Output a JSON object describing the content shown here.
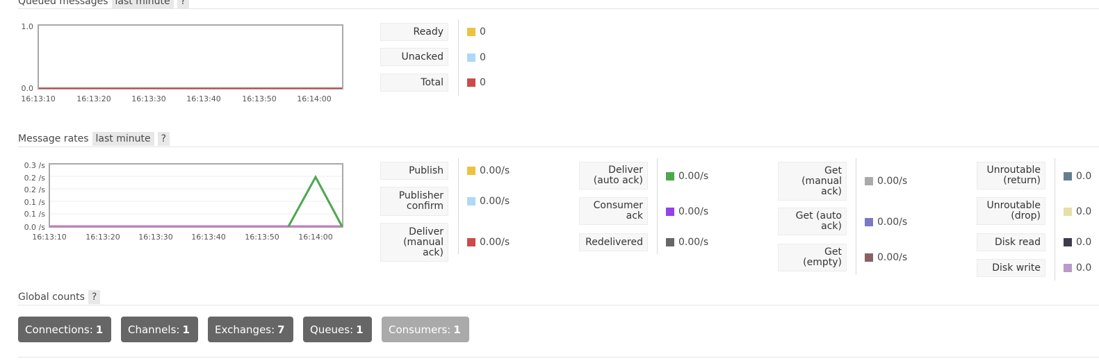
{
  "queued": {
    "title": "Queued messages",
    "range": "last minute",
    "help": "?",
    "chart_data": {
      "type": "line",
      "y_ticks": [
        "1.0",
        "0.0"
      ],
      "x_ticks": [
        "16:13:10",
        "16:13:20",
        "16:13:30",
        "16:13:40",
        "16:13:50",
        "16:14:00"
      ],
      "ylim": [
        0,
        1
      ],
      "series": [
        {
          "name": "Total",
          "color": "#dd4444",
          "values": [
            0,
            0,
            0,
            0,
            0,
            0,
            0
          ]
        }
      ]
    },
    "legend": [
      {
        "label": "Ready",
        "value": "0",
        "color": "#edc240"
      },
      {
        "label": "Unacked",
        "value": "0",
        "color": "#afd8f8"
      },
      {
        "label": "Total",
        "value": "0",
        "color": "#cb4b4b"
      }
    ]
  },
  "rates": {
    "title": "Message rates",
    "range": "last minute",
    "help": "?",
    "chart_data": {
      "type": "line",
      "y_ticks": [
        "0.3 /s",
        "0.2 /s",
        "0.2 /s",
        "0.1 /s",
        "0.1 /s",
        "0.0 /s"
      ],
      "x_ticks": [
        "16:13:10",
        "16:13:20",
        "16:13:30",
        "16:13:40",
        "16:13:50",
        "16:14:00"
      ],
      "ylim": [
        0,
        0.3
      ],
      "series": [
        {
          "name": "Deliver (auto ack)",
          "color": "#4da74d",
          "x": [
            "16:13:55",
            "16:14:00",
            "16:14:05"
          ],
          "values": [
            0,
            0.2,
            0
          ]
        },
        {
          "name": "Consumer ack",
          "color": "#c080c0",
          "x": [
            "16:13:05",
            "16:14:05"
          ],
          "values": [
            0,
            0
          ]
        }
      ]
    },
    "groups": [
      [
        {
          "label": "Publish",
          "value": "0.00/s",
          "color": "#edc240"
        },
        {
          "label": "Publisher confirm",
          "value": "0.00/s",
          "color": "#afd8f8"
        },
        {
          "label": "Deliver (manual ack)",
          "value": "0.00/s",
          "color": "#cb4b4b"
        }
      ],
      [
        {
          "label": "Deliver (auto ack)",
          "value": "0.00/s",
          "color": "#4da74d"
        },
        {
          "label": "Consumer ack",
          "value": "0.00/s",
          "color": "#9440ed"
        },
        {
          "label": "Redelivered",
          "value": "0.00/s",
          "color": "#666666"
        }
      ],
      [
        {
          "label": "Get (manual ack)",
          "value": "0.00/s",
          "color": "#aaaaaa"
        },
        {
          "label": "Get (auto ack)",
          "value": "0.00/s",
          "color": "#7c79c3"
        },
        {
          "label": "Get (empty)",
          "value": "0.00/s",
          "color": "#8a6060"
        }
      ],
      [
        {
          "label": "Unroutable (return)",
          "value": "0.0",
          "color": "#657e8f"
        },
        {
          "label": "Unroutable (drop)",
          "value": "0.0",
          "color": "#e8dfa8"
        },
        {
          "label": "Disk read",
          "value": "0.0",
          "color": "#3c3c4a"
        },
        {
          "label": "Disk write",
          "value": "0.0",
          "color": "#b99ac8"
        }
      ]
    ]
  },
  "global": {
    "title": "Global counts",
    "help": "?",
    "counts": [
      {
        "label": "Connections:",
        "value": "1"
      },
      {
        "label": "Channels:",
        "value": "1"
      },
      {
        "label": "Exchanges:",
        "value": "7"
      },
      {
        "label": "Queues:",
        "value": "1"
      },
      {
        "label": "Consumers:",
        "value": "1"
      }
    ]
  }
}
